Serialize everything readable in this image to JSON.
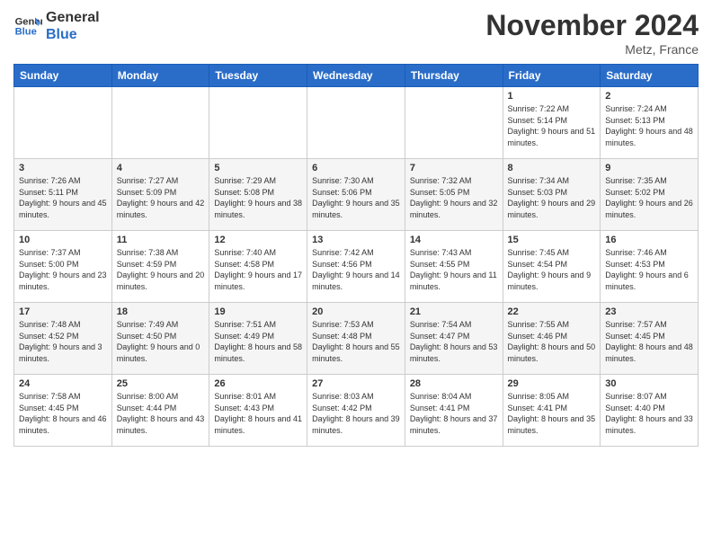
{
  "logo": {
    "line1": "General",
    "line2": "Blue"
  },
  "title": "November 2024",
  "location": "Metz, France",
  "days_header": [
    "Sunday",
    "Monday",
    "Tuesday",
    "Wednesday",
    "Thursday",
    "Friday",
    "Saturday"
  ],
  "weeks": [
    [
      {
        "day": "",
        "info": ""
      },
      {
        "day": "",
        "info": ""
      },
      {
        "day": "",
        "info": ""
      },
      {
        "day": "",
        "info": ""
      },
      {
        "day": "",
        "info": ""
      },
      {
        "day": "1",
        "info": "Sunrise: 7:22 AM\nSunset: 5:14 PM\nDaylight: 9 hours and 51 minutes."
      },
      {
        "day": "2",
        "info": "Sunrise: 7:24 AM\nSunset: 5:13 PM\nDaylight: 9 hours and 48 minutes."
      }
    ],
    [
      {
        "day": "3",
        "info": "Sunrise: 7:26 AM\nSunset: 5:11 PM\nDaylight: 9 hours and 45 minutes."
      },
      {
        "day": "4",
        "info": "Sunrise: 7:27 AM\nSunset: 5:09 PM\nDaylight: 9 hours and 42 minutes."
      },
      {
        "day": "5",
        "info": "Sunrise: 7:29 AM\nSunset: 5:08 PM\nDaylight: 9 hours and 38 minutes."
      },
      {
        "day": "6",
        "info": "Sunrise: 7:30 AM\nSunset: 5:06 PM\nDaylight: 9 hours and 35 minutes."
      },
      {
        "day": "7",
        "info": "Sunrise: 7:32 AM\nSunset: 5:05 PM\nDaylight: 9 hours and 32 minutes."
      },
      {
        "day": "8",
        "info": "Sunrise: 7:34 AM\nSunset: 5:03 PM\nDaylight: 9 hours and 29 minutes."
      },
      {
        "day": "9",
        "info": "Sunrise: 7:35 AM\nSunset: 5:02 PM\nDaylight: 9 hours and 26 minutes."
      }
    ],
    [
      {
        "day": "10",
        "info": "Sunrise: 7:37 AM\nSunset: 5:00 PM\nDaylight: 9 hours and 23 minutes."
      },
      {
        "day": "11",
        "info": "Sunrise: 7:38 AM\nSunset: 4:59 PM\nDaylight: 9 hours and 20 minutes."
      },
      {
        "day": "12",
        "info": "Sunrise: 7:40 AM\nSunset: 4:58 PM\nDaylight: 9 hours and 17 minutes."
      },
      {
        "day": "13",
        "info": "Sunrise: 7:42 AM\nSunset: 4:56 PM\nDaylight: 9 hours and 14 minutes."
      },
      {
        "day": "14",
        "info": "Sunrise: 7:43 AM\nSunset: 4:55 PM\nDaylight: 9 hours and 11 minutes."
      },
      {
        "day": "15",
        "info": "Sunrise: 7:45 AM\nSunset: 4:54 PM\nDaylight: 9 hours and 9 minutes."
      },
      {
        "day": "16",
        "info": "Sunrise: 7:46 AM\nSunset: 4:53 PM\nDaylight: 9 hours and 6 minutes."
      }
    ],
    [
      {
        "day": "17",
        "info": "Sunrise: 7:48 AM\nSunset: 4:52 PM\nDaylight: 9 hours and 3 minutes."
      },
      {
        "day": "18",
        "info": "Sunrise: 7:49 AM\nSunset: 4:50 PM\nDaylight: 9 hours and 0 minutes."
      },
      {
        "day": "19",
        "info": "Sunrise: 7:51 AM\nSunset: 4:49 PM\nDaylight: 8 hours and 58 minutes."
      },
      {
        "day": "20",
        "info": "Sunrise: 7:53 AM\nSunset: 4:48 PM\nDaylight: 8 hours and 55 minutes."
      },
      {
        "day": "21",
        "info": "Sunrise: 7:54 AM\nSunset: 4:47 PM\nDaylight: 8 hours and 53 minutes."
      },
      {
        "day": "22",
        "info": "Sunrise: 7:55 AM\nSunset: 4:46 PM\nDaylight: 8 hours and 50 minutes."
      },
      {
        "day": "23",
        "info": "Sunrise: 7:57 AM\nSunset: 4:45 PM\nDaylight: 8 hours and 48 minutes."
      }
    ],
    [
      {
        "day": "24",
        "info": "Sunrise: 7:58 AM\nSunset: 4:45 PM\nDaylight: 8 hours and 46 minutes."
      },
      {
        "day": "25",
        "info": "Sunrise: 8:00 AM\nSunset: 4:44 PM\nDaylight: 8 hours and 43 minutes."
      },
      {
        "day": "26",
        "info": "Sunrise: 8:01 AM\nSunset: 4:43 PM\nDaylight: 8 hours and 41 minutes."
      },
      {
        "day": "27",
        "info": "Sunrise: 8:03 AM\nSunset: 4:42 PM\nDaylight: 8 hours and 39 minutes."
      },
      {
        "day": "28",
        "info": "Sunrise: 8:04 AM\nSunset: 4:41 PM\nDaylight: 8 hours and 37 minutes."
      },
      {
        "day": "29",
        "info": "Sunrise: 8:05 AM\nSunset: 4:41 PM\nDaylight: 8 hours and 35 minutes."
      },
      {
        "day": "30",
        "info": "Sunrise: 8:07 AM\nSunset: 4:40 PM\nDaylight: 8 hours and 33 minutes."
      }
    ]
  ]
}
